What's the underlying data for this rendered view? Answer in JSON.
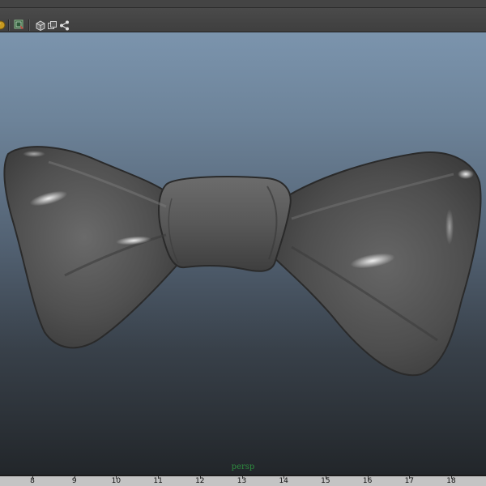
{
  "toolbar": {
    "icons": [
      "shading-ball-icon",
      "separator-icon",
      "select-camera-icon",
      "separator-icon",
      "wireframe-cube-icon",
      "isolate-select-icon",
      "xray-node-icon"
    ]
  },
  "viewport": {
    "camera_label": "persp",
    "object": "bow-tie-mesh"
  },
  "timeline": {
    "ticks": [
      "8",
      "9",
      "10",
      "11",
      "12",
      "13",
      "14",
      "15",
      "16",
      "17",
      "18"
    ]
  },
  "colors": {
    "camera_label": "#2e8b3f",
    "viewport_top": "#7b94ad",
    "viewport_bottom": "#22262a",
    "mesh": "#5a5a5a"
  }
}
